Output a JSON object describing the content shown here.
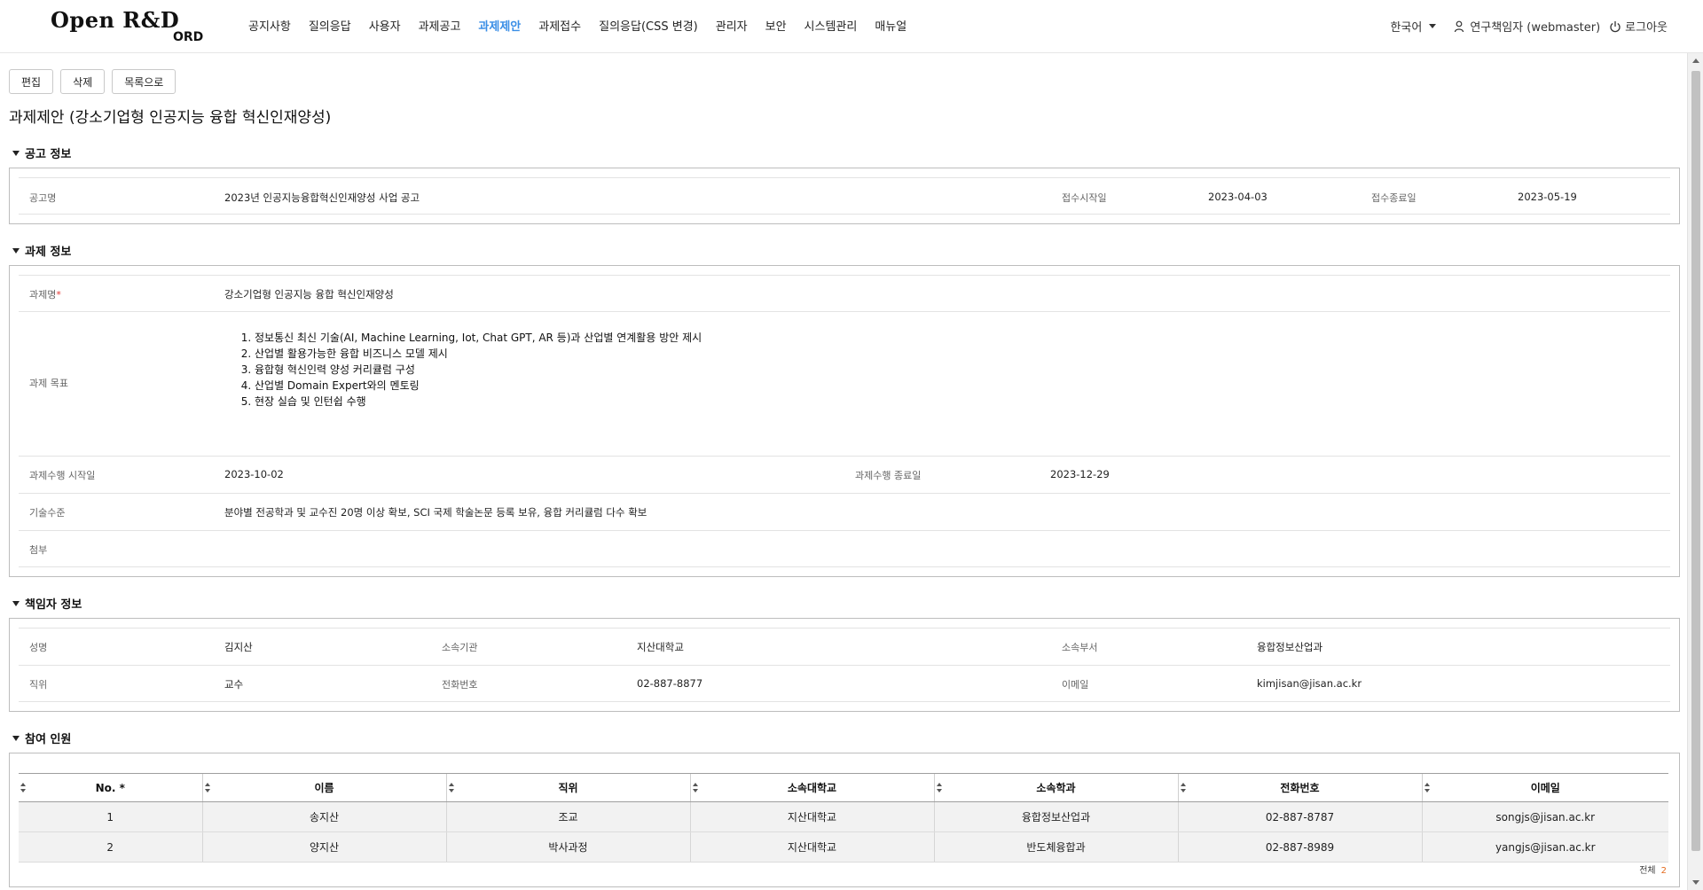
{
  "header": {
    "logo": "Open R&D",
    "logo_sub": "ORD",
    "nav": [
      {
        "label": "공지사항",
        "active": false
      },
      {
        "label": "질의응답",
        "active": false
      },
      {
        "label": "사용자",
        "active": false
      },
      {
        "label": "과제공고",
        "active": false
      },
      {
        "label": "과제제안",
        "active": true
      },
      {
        "label": "과제접수",
        "active": false
      },
      {
        "label": "질의응답(CSS 변경)",
        "active": false
      },
      {
        "label": "관리자",
        "active": false
      },
      {
        "label": "보안",
        "active": false
      },
      {
        "label": "시스템관리",
        "active": false
      },
      {
        "label": "매뉴얼",
        "active": false
      }
    ],
    "language": "한국어",
    "user": "연구책임자 (webmaster)",
    "logout": "로그아웃",
    "accent_color": "#3a8ee6"
  },
  "toolbar": {
    "edit": "편집",
    "delete": "삭제",
    "list": "목록으로"
  },
  "page_title": "과제제안 (강소기업형 인공지능 융합 혁신인재양성)",
  "notice": {
    "title": "공고 정보",
    "name_label": "공고명",
    "name": "2023년 인공지능융합혁신인재양성 사업 공고",
    "start_label": "접수시작일",
    "start": "2023-04-03",
    "end_label": "접수종료일",
    "end": "2023-05-19"
  },
  "project": {
    "title": "과제 정보",
    "name_label": "과제명",
    "required_mark": "*",
    "name": "강소기업형 인공지능 융합 혁신인재양성",
    "goal_label": "과제 목표",
    "goals": [
      "정보통신 최신 기술(AI, Machine Learning, Iot, Chat GPT, AR 등)과 산업별 연계활용 방안 제시",
      "산업별 활용가능한 융합 비즈니스 모델 제시",
      "융합형 혁신인력 양성 커리큘럼 구성",
      "산업별 Domain Expert와의 멘토링",
      "현장 실습 및 인턴쉽 수행"
    ],
    "start_label": "과제수행 시작일",
    "start": "2023-10-02",
    "end_label": "과제수행 종료일",
    "end": "2023-12-29",
    "tech_label": "기술수준",
    "tech": "분야별 전공학과 및 교수진 20명 이상 확보, SCI 국제 학술논문 등록 보유, 융합 커리큘럼 다수 확보",
    "attach_label": "첨부"
  },
  "manager": {
    "title": "책임자 정보",
    "name_label": "성명",
    "name": "김지산",
    "org_label": "소속기관",
    "org": "지산대학교",
    "dept_label": "소속부서",
    "dept": "융합정보산업과",
    "position_label": "직위",
    "position": "교수",
    "phone_label": "전화번호",
    "phone": "02-887-8877",
    "email_label": "이메일",
    "email": "kimjisan@jisan.ac.kr"
  },
  "members": {
    "title": "참여 인원",
    "columns": [
      "No. *",
      "이름",
      "직위",
      "소속대학교",
      "소속학과",
      "전화번호",
      "이메일"
    ],
    "rows": [
      [
        "1",
        "송지산",
        "조교",
        "지산대학교",
        "융합정보산업과",
        "02-887-8787",
        "songjs@jisan.ac.kr"
      ],
      [
        "2",
        "양지산",
        "박사과정",
        "지산대학교",
        "반도체융합과",
        "02-887-8989",
        "yangjs@jisan.ac.kr"
      ]
    ],
    "total_label": "전체",
    "total": "2"
  }
}
